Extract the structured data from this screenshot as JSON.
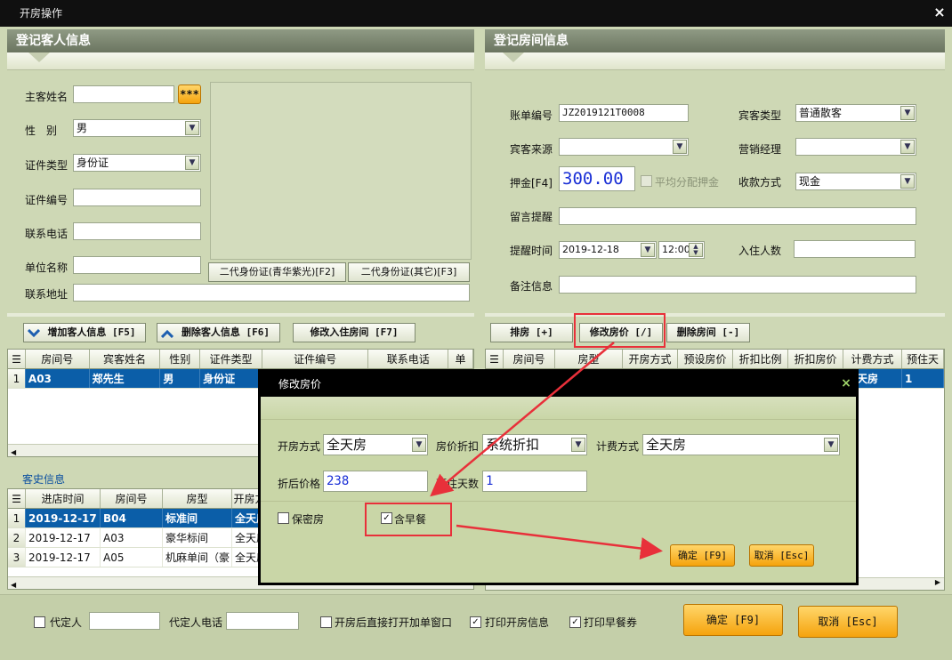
{
  "window": {
    "title": "开房操作",
    "close": "×"
  },
  "guest": {
    "header": "登记客人信息",
    "name_label": "主客姓名",
    "name_value": "",
    "name_btn": "***",
    "gender_label": "性　别",
    "gender_value": "男",
    "idtype_label": "证件类型",
    "idtype_value": "身份证",
    "idno_label": "证件编号",
    "idno_value": "",
    "phone_label": "联系电话",
    "phone_value": "",
    "company_label": "单位名称",
    "company_value": "",
    "address_label": "联系地址",
    "address_value": "",
    "idcard_btn1": "二代身份证(青华紫光)[F2]",
    "idcard_btn2": "二代身份证(其它)[F3]"
  },
  "room": {
    "header": "登记房间信息",
    "bill_label": "账单编号",
    "bill_value": "JZ2019121T0008",
    "guesttype_label": "宾客类型",
    "guesttype_value": "普通散客",
    "source_label": "宾客来源",
    "source_value": "",
    "manager_label": "营销经理",
    "manager_value": "",
    "deposit_label": "押金[F4]",
    "deposit_value": "300.00",
    "avg_deposit_label": "平均分配押金",
    "payment_label": "收款方式",
    "payment_value": "现金",
    "message_label": "留言提醒",
    "message_value": "",
    "remind_label": "提醒时间",
    "remind_date": "2019-12-18",
    "remind_time": "12:00",
    "guests_label": "入住人数",
    "guests_value": "",
    "remark_label": "备注信息",
    "remark_value": ""
  },
  "guest_toolbar": {
    "add": "增加客人信息 [F5]",
    "delete": "删除客人信息 [F6]",
    "modify": "修改入住房间 [F7]"
  },
  "room_toolbar": {
    "arrange": "排房 [+]",
    "modify_price": "修改房价 [/]",
    "delete_room": "删除房间 [-]"
  },
  "guest_table": {
    "headers": [
      "房间号",
      "宾客姓名",
      "性别",
      "证件类型",
      "证件编号",
      "联系电话",
      "单"
    ],
    "rows": [
      {
        "num": "1",
        "cells": [
          "A03",
          "郑先生",
          "男",
          "身份证",
          "",
          "",
          ""
        ]
      }
    ]
  },
  "room_table": {
    "headers": [
      "房间号",
      "房型",
      "开房方式",
      "预设房价",
      "折扣比例",
      "折扣房价",
      "计费方式",
      "预住天"
    ],
    "rows": [
      {
        "num": "1",
        "cells": [
          "",
          "",
          "",
          "",
          "",
          "",
          "全天房",
          "1"
        ]
      }
    ]
  },
  "history": {
    "title": "客史信息",
    "headers": [
      "进店时间",
      "房间号",
      "房型",
      "开房方"
    ],
    "rows": [
      {
        "num": "1",
        "cells": [
          "2019-12-17",
          "B04",
          "标准间",
          "全天房"
        ]
      },
      {
        "num": "2",
        "cells": [
          "2019-12-17",
          "A03",
          "豪华标间",
          "全天房"
        ]
      },
      {
        "num": "3",
        "cells": [
          "2019-12-17",
          "A05",
          "机麻单间（豪",
          "全天房"
        ]
      }
    ]
  },
  "modal": {
    "title": "修改房价",
    "close": "×",
    "mode_label": "开房方式",
    "mode_value": "全天房",
    "discount_label": "房价折扣",
    "discount_value": "系统折扣",
    "billing_label": "计费方式",
    "billing_value": "全天房",
    "price_label": "折后价格",
    "price_value": "238",
    "days_label": "预住天数",
    "days_value": "1",
    "secret_label": "保密房",
    "breakfast_label": "含早餐",
    "ok": "确定 [F9]",
    "cancel": "取消 [Esc]"
  },
  "footer": {
    "agent_label": "代定人",
    "agent_value": "",
    "agent_phone_label": "代定人电话",
    "agent_phone_value": "",
    "open_window_label": "开房后直接打开加单窗口",
    "print_open_label": "打印开房信息",
    "print_breakfast_label": "打印早餐券",
    "ok": "确定 [F9]",
    "cancel": "取消 [Esc]"
  },
  "colors": {
    "selected_row": "#0b5ea8",
    "accent_orange": "#f5a30d",
    "annotation_red": "#e8303a",
    "deposit_blue": "#1a2fd6"
  }
}
